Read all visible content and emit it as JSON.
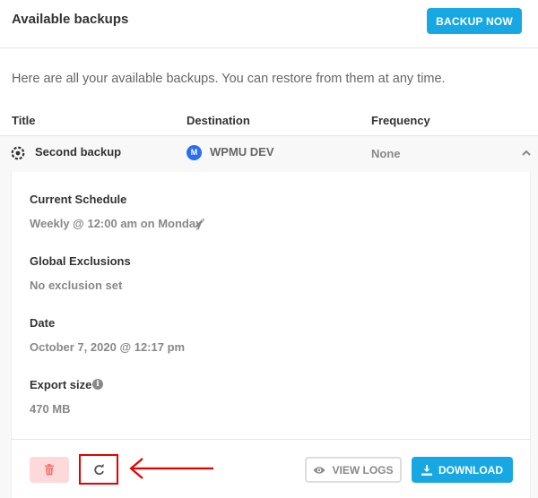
{
  "header": {
    "title": "Available backups",
    "backup_now_label": "BACKUP NOW"
  },
  "intro_text": "Here are all your available backups. You can restore from them at any time.",
  "table": {
    "columns": [
      "Title",
      "Destination",
      "Frequency"
    ],
    "row": {
      "title": "Second backup",
      "destination": "WPMU DEV",
      "frequency": "None"
    }
  },
  "details": {
    "current_schedule_label": "Current Schedule",
    "current_schedule_value": "Weekly @ 12:00 am on Monday",
    "global_exclusions_label": "Global Exclusions",
    "global_exclusions_value": "No exclusion set",
    "date_label": "Date",
    "date_value": "October 7, 2020 @ 12:17 pm",
    "export_size_label": "Export size",
    "export_size_value": "470 MB"
  },
  "actions": {
    "view_logs_label": "VIEW LOGS",
    "download_label": "DOWNLOAD"
  },
  "icons": {
    "row": "backup-gear-icon",
    "destination": "wpmu-dev-icon",
    "expand": "chevron-up-icon",
    "edit": "pencil-icon",
    "info": "info-icon",
    "delete": "trash-icon",
    "restore": "restore-icon",
    "logs": "eye-icon",
    "download": "download-icon"
  },
  "colors": {
    "accent": "#17a8e3",
    "delete_bg": "#fdd9d9",
    "delete_icon": "#f47474",
    "annotation": "#e60000",
    "wpmu_blue": "#286ef1"
  }
}
